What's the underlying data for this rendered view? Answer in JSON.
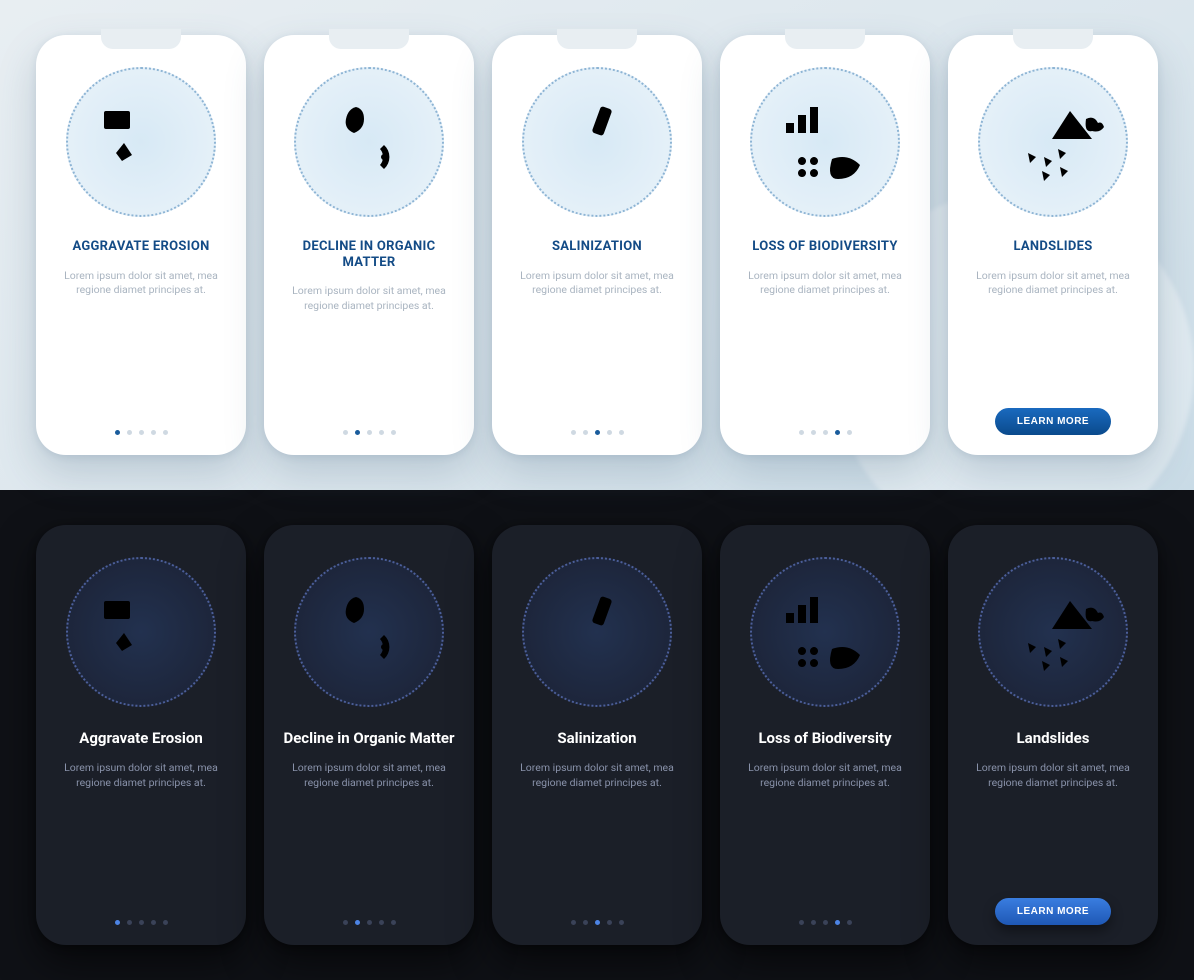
{
  "common": {
    "desc": "Lorem ipsum dolor sit amet, mea regione diamet principes at.",
    "cta_label": "LEARN MORE"
  },
  "light": {
    "cards": [
      {
        "title": "AGGRAVATE EROSION",
        "icon": "erosion",
        "dots_total": 5,
        "dots_active": 0
      },
      {
        "title": "DECLINE IN ORGANIC MATTER",
        "icon": "organic",
        "dots_total": 5,
        "dots_active": 1
      },
      {
        "title": "SALINIZATION",
        "icon": "salinization",
        "dots_total": 5,
        "dots_active": 2
      },
      {
        "title": "LOSS OF BIODIVERSITY",
        "icon": "biodiversity",
        "dots_total": 5,
        "dots_active": 3
      },
      {
        "title": "LANDSLIDES",
        "icon": "landslides",
        "cta": true
      }
    ]
  },
  "dark": {
    "cards": [
      {
        "title": "Aggravate Erosion",
        "icon": "erosion",
        "dots_total": 5,
        "dots_active": 0
      },
      {
        "title": "Decline in Organic Matter",
        "icon": "organic",
        "dots_total": 5,
        "dots_active": 1
      },
      {
        "title": "Salinization",
        "icon": "salinization",
        "dots_total": 5,
        "dots_active": 2
      },
      {
        "title": "Loss of Biodiversity",
        "icon": "biodiversity",
        "dots_total": 5,
        "dots_active": 3
      },
      {
        "title": "Landslides",
        "icon": "landslides",
        "cta": true
      }
    ]
  }
}
